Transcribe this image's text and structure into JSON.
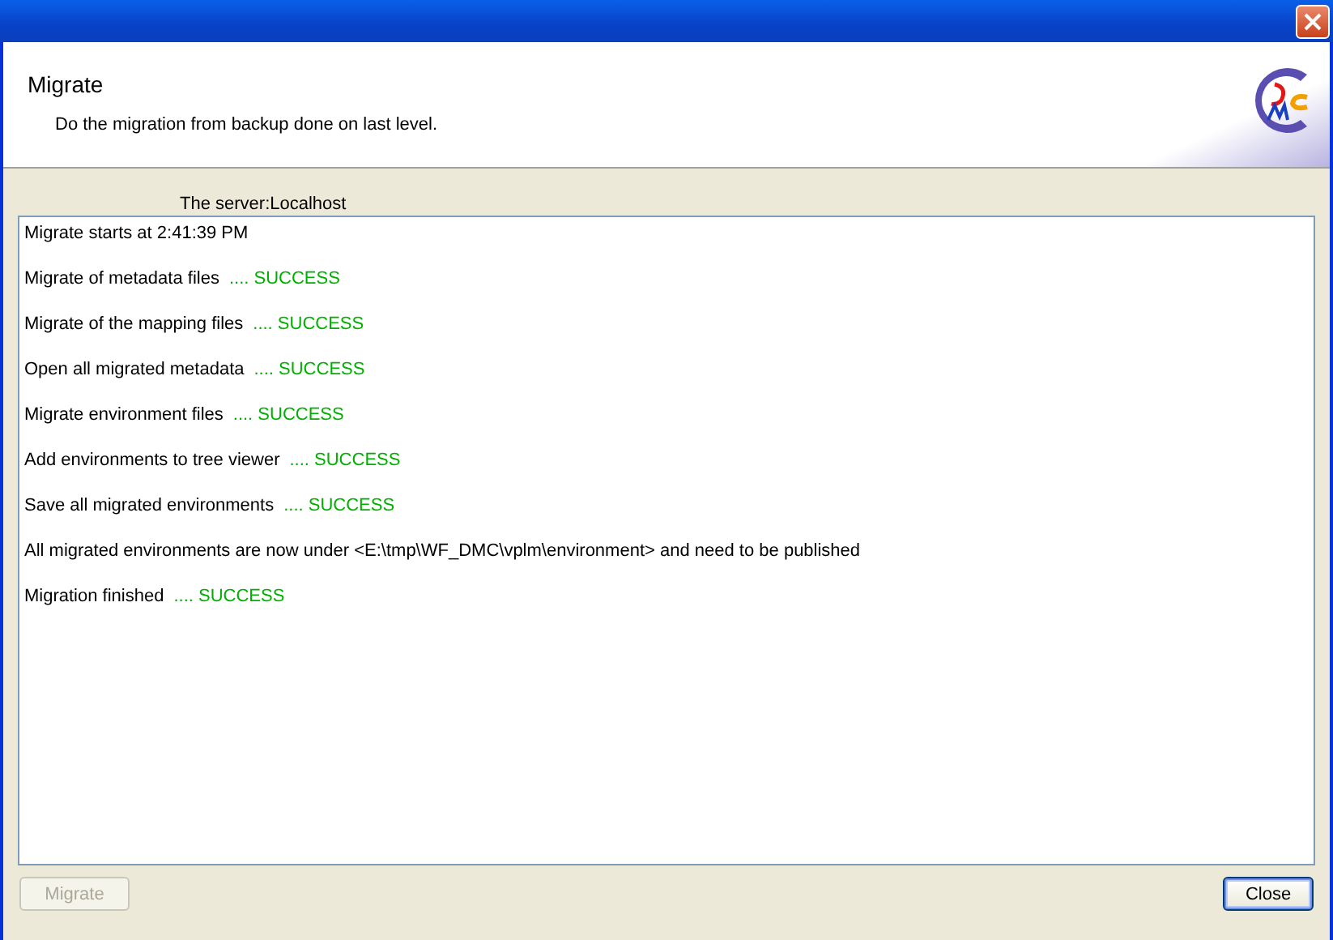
{
  "header": {
    "title": "Migrate",
    "description": "Do the migration from backup done on last level."
  },
  "server_label": "The server:Localhost",
  "log": [
    {
      "text": "Migrate starts at 2:41:39 PM"
    },
    {
      "text": "Migrate of metadata files",
      "status": ".... SUCCESS",
      "kind": "success"
    },
    {
      "text": "Migrate of the mapping files",
      "status": ".... SUCCESS",
      "kind": "success"
    },
    {
      "text": "Open all migrated metadata",
      "status": ".... SUCCESS",
      "kind": "success"
    },
    {
      "text": "Migrate environment files",
      "status": ".... SUCCESS",
      "kind": "success"
    },
    {
      "text": "Add environments to tree viewer",
      "status": ".... SUCCESS",
      "kind": "success"
    },
    {
      "text": "Save all migrated environments",
      "status": ".... SUCCESS",
      "kind": "success"
    },
    {
      "text": "All migrated environments are now under <E:\\tmp\\WF_DMC\\vplm\\environment> and need to be published"
    },
    {
      "text": "Migration finished",
      "status": ".... SUCCESS",
      "kind": "success"
    }
  ],
  "buttons": [
    {
      "label": "Migrate",
      "disabled": true,
      "default": false
    },
    {
      "label": "Close",
      "disabled": false,
      "default": true
    }
  ]
}
